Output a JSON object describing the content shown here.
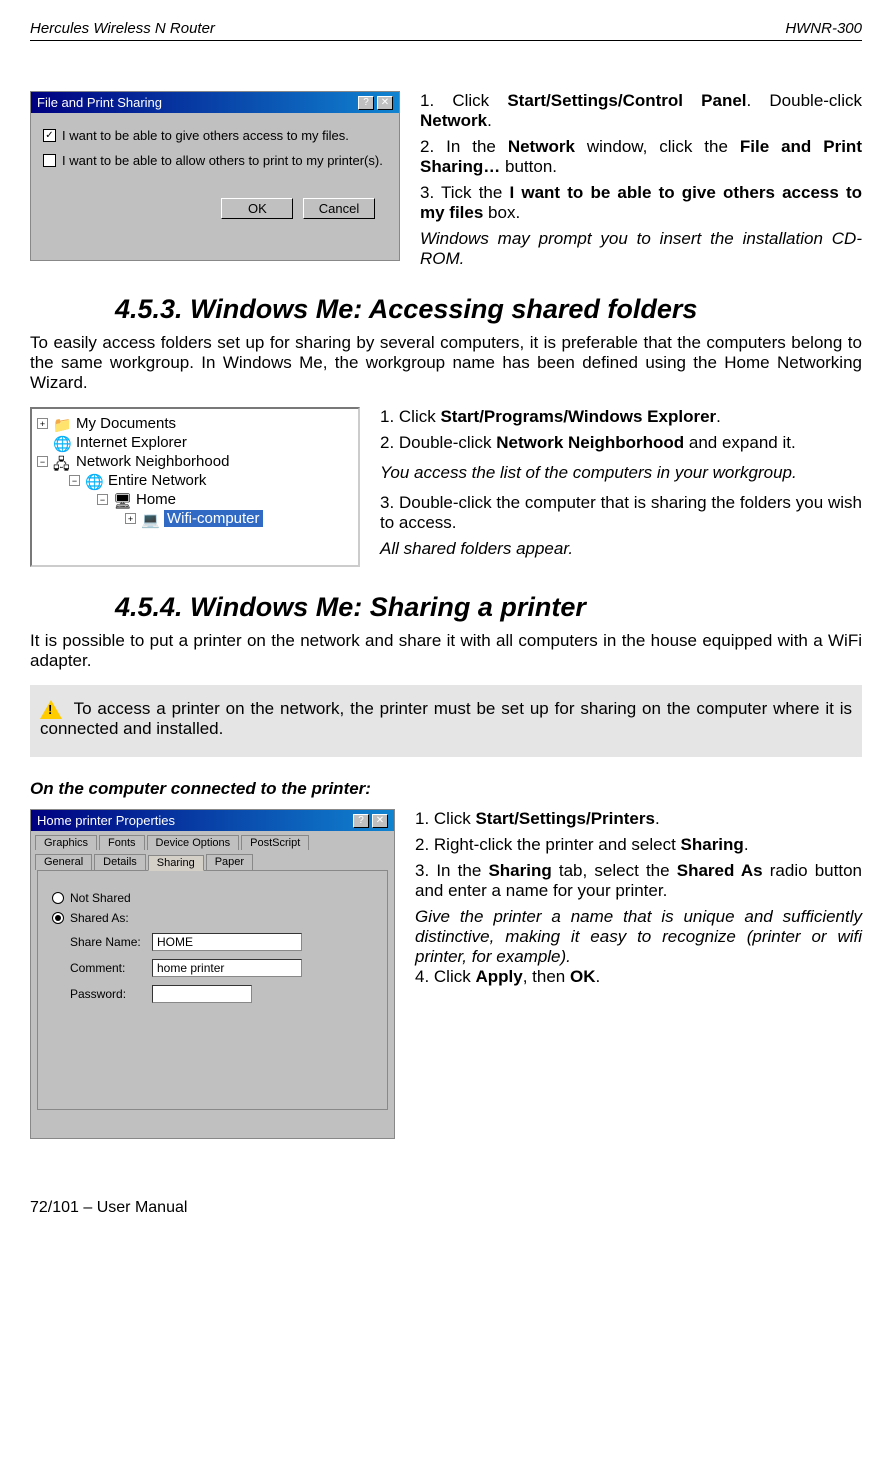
{
  "header": {
    "left": "Hercules Wireless N Router",
    "right": "HWNR-300"
  },
  "dialog1": {
    "title": "File and Print Sharing",
    "chk1": "I want to be able to give others access to my files.",
    "chk2": "I want to be able to allow others to print to my printer(s).",
    "ok": "OK",
    "cancel": "Cancel"
  },
  "steps1": {
    "s1a": "1. Click ",
    "s1b": "Start/Settings/Control Panel",
    "s1c": ".  Double-click ",
    "s1d": "Network",
    "s1e": ".",
    "s2a": "2. In the ",
    "s2b": "Network",
    "s2c": " window, click the ",
    "s2d": "File and Print Sharing…",
    "s2e": " button.",
    "s3a": "3. Tick the ",
    "s3b": "I want to be able to give others access to my files",
    "s3c": " box.",
    "note": "Windows may prompt you to insert the installation CD-ROM."
  },
  "section453": {
    "title": "4.5.3.  Windows Me: Accessing shared folders"
  },
  "para453": "To easily access folders set up for sharing by several computers, it is preferable that the computers belong to the same workgroup.  In Windows Me, the workgroup name has been defined using the Home Networking Wizard.",
  "tree": {
    "t1": "My Documents",
    "t2": "Internet Explorer",
    "t3": "Network Neighborhood",
    "t4": "Entire Network",
    "t5": "Home",
    "t6": "Wifi-computer"
  },
  "steps2": {
    "s1a": "1. Click ",
    "s1b": "Start/Programs/Windows Explorer",
    "s1c": ".",
    "s2a": "2. Double-click ",
    "s2b": "Network Neighborhood",
    "s2c": " and expand it.",
    "note1": "You access the list of the computers in your workgroup.",
    "s3": "3. Double-click the computer that is sharing the folders you wish to access.",
    "note2": "All shared folders appear."
  },
  "section454": {
    "title": "4.5.4. Windows Me: Sharing a printer"
  },
  "para454": "It is possible to put a printer on the network and share it with all computers in the house equipped with a WiFi adapter.",
  "warn": " To access a printer on the network, the printer must be set up for sharing on the computer where it is connected and installed.",
  "subhead": "On the computer connected to the printer:",
  "dialog2": {
    "title": "Home printer Properties",
    "tabs": [
      "Graphics",
      "Fonts",
      "Device Options",
      "PostScript",
      "General",
      "Details",
      "Sharing",
      "Paper"
    ],
    "notshared": "Not Shared",
    "sharedas": "Shared As:",
    "sharename_l": "Share Name:",
    "sharename_v": "HOME",
    "comment_l": "Comment:",
    "comment_v": "home printer",
    "password_l": "Password:",
    "password_v": ""
  },
  "steps3": {
    "s1a": "1. Click ",
    "s1b": "Start/Settings/Printers",
    "s1c": ".",
    "s2a": "2. Right-click the printer and select ",
    "s2b": "Sharing",
    "s2c": ".",
    "s3a": "3. In the ",
    "s3b": "Sharing",
    "s3c": " tab, select the ",
    "s3d": "Shared As",
    "s3e": " radio button and enter a name for your printer.",
    "note": "Give the printer a name that is unique and sufficiently distinctive, making it easy to recognize (printer or wifi printer, for example).",
    "s4a": "4. Click ",
    "s4b": "Apply",
    "s4c": ", then ",
    "s4d": "OK",
    "s4e": "."
  },
  "footer": "72/101 – User Manual"
}
